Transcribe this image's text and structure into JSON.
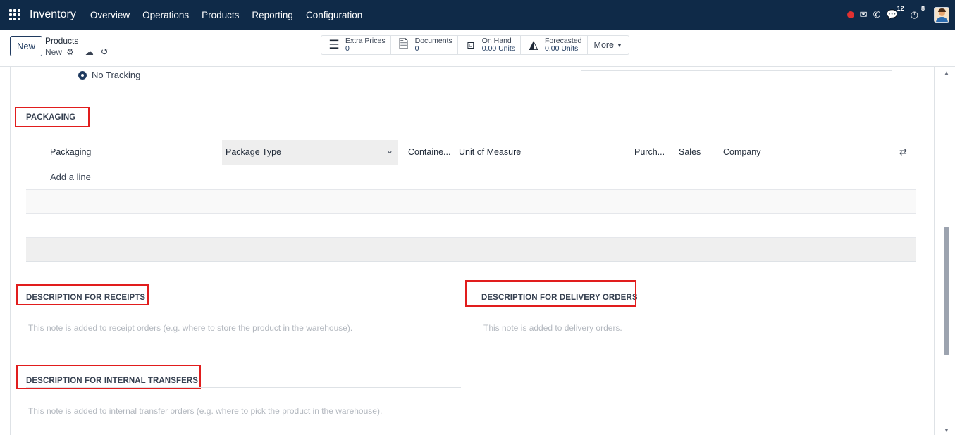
{
  "navbar": {
    "app_name": "Inventory",
    "menu": [
      "Overview",
      "Operations",
      "Products",
      "Reporting",
      "Configuration"
    ],
    "messages_count": "12",
    "activities_count": "8"
  },
  "control_panel": {
    "new_button": "New",
    "breadcrumb_parent": "Products",
    "breadcrumb_current": "New",
    "stats": [
      {
        "label": "Extra Prices",
        "value": "0",
        "icon": "list-icon"
      },
      {
        "label": "Documents",
        "value": "0",
        "icon": "document-icon"
      },
      {
        "label": "On Hand",
        "value": "0.00 Units",
        "icon": "cubes-icon"
      },
      {
        "label": "Forecasted",
        "value": "0.00 Units",
        "icon": "area-chart-icon"
      }
    ],
    "more_label": "More"
  },
  "tracking": {
    "selected_option": "No Tracking"
  },
  "packaging": {
    "title": "PACKAGING",
    "columns": [
      "Packaging",
      "Package Type",
      "Containe...",
      "Unit of Measure",
      "Purch...",
      "Sales",
      "Company"
    ],
    "add_line": "Add a line"
  },
  "descriptions": {
    "receipts_title": "DESCRIPTION FOR RECEIPTS",
    "receipts_placeholder": "This note is added to receipt orders (e.g. where to store the product in the warehouse).",
    "delivery_title": "DESCRIPTION FOR DELIVERY ORDERS",
    "delivery_placeholder": "This note is added to delivery orders.",
    "internal_title": "DESCRIPTION FOR INTERNAL TRANSFERS",
    "internal_placeholder": "This note is added to internal transfer orders (e.g. where to pick the product in the warehouse)."
  },
  "colors": {
    "navbar_bg": "#0f2a48",
    "highlight_box": "#e11d1d",
    "accent": "#1f3a5f"
  }
}
